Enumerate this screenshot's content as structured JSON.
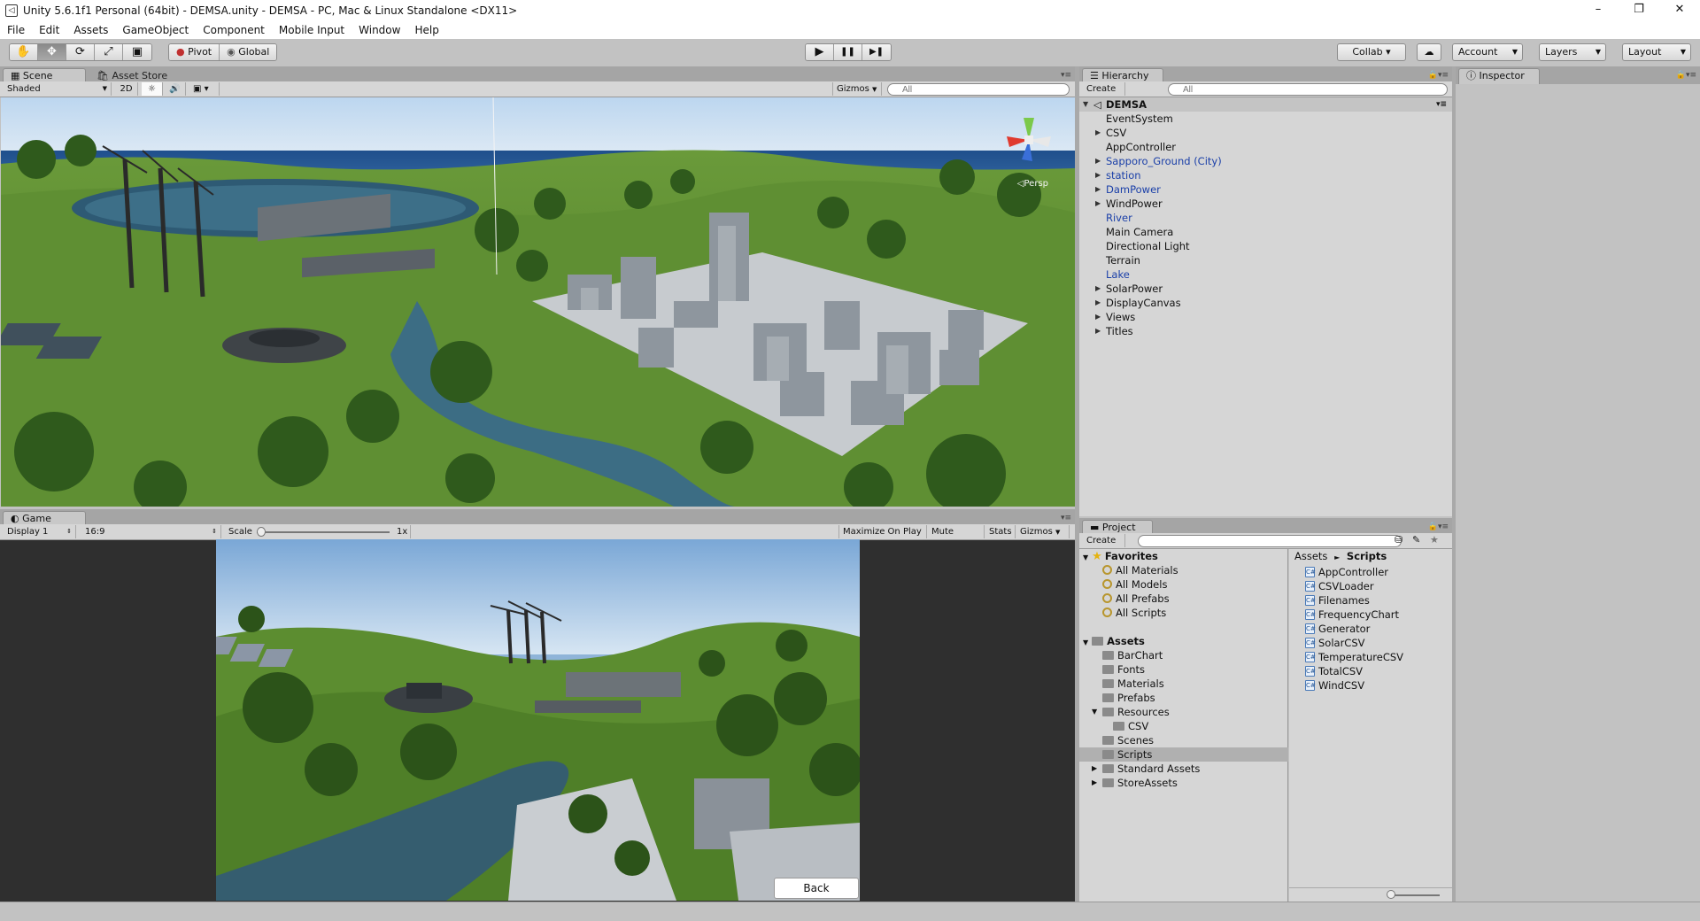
{
  "window": {
    "title": "Unity 5.6.1f1 Personal (64bit) - DEMSA.unity - DEMSA - PC, Mac & Linux Standalone <DX11>",
    "minimize": "–",
    "maximize": "❐",
    "close": "✕"
  },
  "menu": [
    "File",
    "Edit",
    "Assets",
    "GameObject",
    "Component",
    "Mobile Input",
    "Window",
    "Help"
  ],
  "toolbar": {
    "tools": [
      "✋",
      "✥",
      "⟳",
      "⤢",
      "▣"
    ],
    "pivot": "Pivot",
    "global": "Global",
    "play": "▶",
    "pause": "❚❚",
    "step": "▶❚",
    "collab": "Collab ▾",
    "cloud": "☁",
    "account": "Account",
    "layers": "Layers",
    "layout": "Layout"
  },
  "scene": {
    "tab_scene": "Scene",
    "tab_asset_store": "Asset Store",
    "shading": "Shaded",
    "mode_2d": "2D",
    "gizmos": "Gizmos",
    "search_placeholder": "All",
    "persp": "Persp"
  },
  "game": {
    "tab": "Game",
    "display": "Display 1",
    "aspect": "16:9",
    "scale_label": "Scale",
    "scale_value": "1x",
    "maximize_on_play": "Maximize On Play",
    "mute_audio": "Mute Audio",
    "stats": "Stats",
    "gizmos": "Gizmos",
    "back_button": "Back"
  },
  "hierarchy": {
    "tab": "Hierarchy",
    "create": "Create",
    "search_placeholder": "All",
    "scene_name": "DEMSA",
    "items": [
      {
        "label": "EventSystem",
        "arrow": "",
        "prefab": false
      },
      {
        "label": "CSV",
        "arrow": "▶",
        "prefab": false
      },
      {
        "label": "AppController",
        "arrow": "",
        "prefab": false
      },
      {
        "label": "Sapporo_Ground (City)",
        "arrow": "▶",
        "prefab": true
      },
      {
        "label": "station",
        "arrow": "▶",
        "prefab": true
      },
      {
        "label": "DamPower",
        "arrow": "▶",
        "prefab": true
      },
      {
        "label": "WindPower",
        "arrow": "▶",
        "prefab": false
      },
      {
        "label": "River",
        "arrow": "",
        "prefab": true
      },
      {
        "label": "Main Camera",
        "arrow": "",
        "prefab": false
      },
      {
        "label": "Directional Light",
        "arrow": "",
        "prefab": false
      },
      {
        "label": "Terrain",
        "arrow": "",
        "prefab": false
      },
      {
        "label": "Lake",
        "arrow": "",
        "prefab": true
      },
      {
        "label": "SolarPower",
        "arrow": "▶",
        "prefab": false
      },
      {
        "label": "DisplayCanvas",
        "arrow": "▶",
        "prefab": false
      },
      {
        "label": "Views",
        "arrow": "▶",
        "prefab": false
      },
      {
        "label": "Titles",
        "arrow": "▶",
        "prefab": false
      }
    ]
  },
  "project": {
    "tab": "Project",
    "create": "Create",
    "favorites_label": "Favorites",
    "favorites": [
      "All Materials",
      "All Models",
      "All Prefabs",
      "All Scripts"
    ],
    "assets_label": "Assets",
    "folders": [
      {
        "label": "BarChart",
        "depth": 1,
        "arrow": "",
        "selected": false
      },
      {
        "label": "Fonts",
        "depth": 1,
        "arrow": "",
        "selected": false
      },
      {
        "label": "Materials",
        "depth": 1,
        "arrow": "",
        "selected": false
      },
      {
        "label": "Prefabs",
        "depth": 1,
        "arrow": "",
        "selected": false
      },
      {
        "label": "Resources",
        "depth": 1,
        "arrow": "▼",
        "selected": false
      },
      {
        "label": "CSV",
        "depth": 2,
        "arrow": "",
        "selected": false
      },
      {
        "label": "Scenes",
        "depth": 1,
        "arrow": "",
        "selected": false
      },
      {
        "label": "Scripts",
        "depth": 1,
        "arrow": "",
        "selected": true
      },
      {
        "label": "Standard Assets",
        "depth": 1,
        "arrow": "▶",
        "selected": false
      },
      {
        "label": "StoreAssets",
        "depth": 1,
        "arrow": "▶",
        "selected": false
      }
    ],
    "breadcrumb_root": "Assets",
    "breadcrumb_sep": "►",
    "breadcrumb_current": "Scripts",
    "scripts": [
      "AppController",
      "CSVLoader",
      "Filenames",
      "FrequencyChart",
      "Generator",
      "SolarCSV",
      "TemperatureCSV",
      "TotalCSV",
      "WindCSV"
    ]
  },
  "inspector": {
    "tab": "Inspector"
  }
}
